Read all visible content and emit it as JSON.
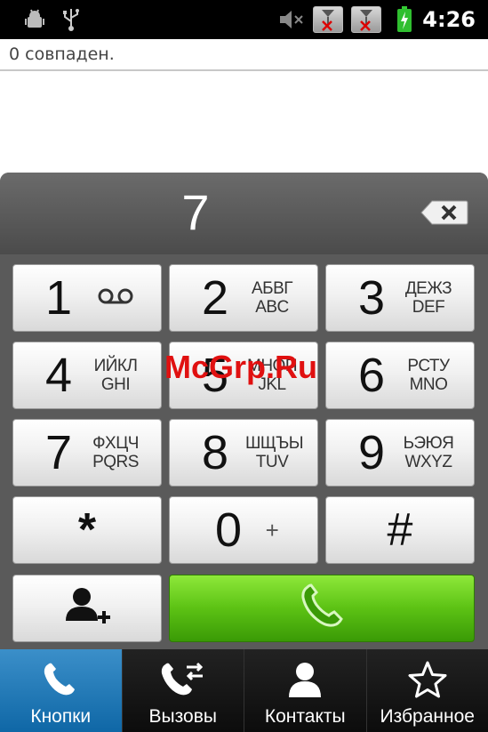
{
  "status_bar": {
    "time": "4:26",
    "icons": [
      "debug-icon",
      "usb-icon",
      "mute-icon",
      "no-sim-1-icon",
      "no-sim-2-icon",
      "battery-charging-icon"
    ],
    "sim1_label": "1",
    "sim2_label": "2"
  },
  "matches": {
    "text": "0 совпаден."
  },
  "dialer": {
    "entered": "7",
    "backspace_icon": "backspace-icon",
    "keys": [
      {
        "digit": "1",
        "letters_top": "",
        "letters_bottom": "",
        "icon": "voicemail-icon"
      },
      {
        "digit": "2",
        "letters_top": "АБВГ",
        "letters_bottom": "ABC"
      },
      {
        "digit": "3",
        "letters_top": "ДЕЖЗ",
        "letters_bottom": "DEF"
      },
      {
        "digit": "4",
        "letters_top": "ИЙКЛ",
        "letters_bottom": "GHI"
      },
      {
        "digit": "5",
        "letters_top": "МНОП",
        "letters_bottom": "JKL"
      },
      {
        "digit": "6",
        "letters_top": "РСТУ",
        "letters_bottom": "MNO"
      },
      {
        "digit": "7",
        "letters_top": "ФХЦЧ",
        "letters_bottom": "PQRS"
      },
      {
        "digit": "8",
        "letters_top": "ШЩЪЫ",
        "letters_bottom": "TUV"
      },
      {
        "digit": "9",
        "letters_top": "ЬЭЮЯ",
        "letters_bottom": "WXYZ"
      },
      {
        "digit": "*",
        "letters_top": "",
        "letters_bottom": ""
      },
      {
        "digit": "0",
        "letters_top": "+",
        "letters_bottom": ""
      },
      {
        "digit": "#",
        "letters_top": "",
        "letters_bottom": ""
      }
    ],
    "add_contact_icon": "add-contact-icon",
    "call_icon": "phone-call-icon",
    "call_color": "#5cc214"
  },
  "tabs": [
    {
      "label": "Кнопки",
      "icon": "phone-icon",
      "active": true
    },
    {
      "label": "Вызовы",
      "icon": "call-log-icon",
      "active": false
    },
    {
      "label": "Контакты",
      "icon": "contacts-icon",
      "active": false
    },
    {
      "label": "Избранное",
      "icon": "star-icon",
      "active": false
    }
  ],
  "watermark": "McGrp.Ru",
  "colors": {
    "accent": "#1a7bc0",
    "watermark": "#e01010"
  }
}
